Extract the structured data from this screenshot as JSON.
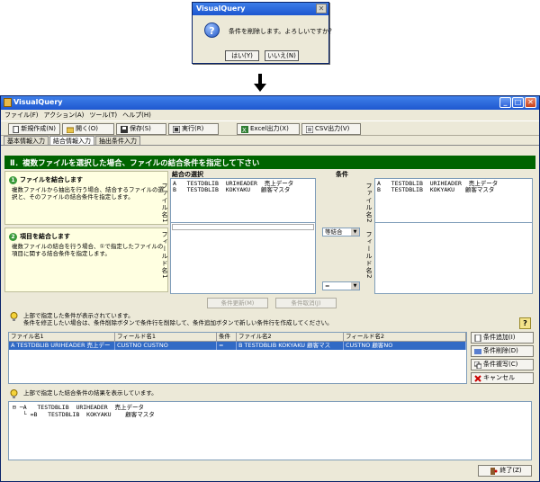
{
  "dialog": {
    "title": "VisualQuery",
    "message": "条件を削除します。よろしいですか？",
    "yes_label": "はい(Y)",
    "no_label": "いいえ(N)"
  },
  "window": {
    "title": "VisualQuery",
    "menu": [
      "ファイル(F)",
      "アクション(A)",
      "ツール(T)",
      "ヘルプ(H)"
    ],
    "toolbar": {
      "new_label": "新規作成(N)",
      "open_label": "開く(O)",
      "save_label": "保存(S)",
      "run_label": "実行(R)",
      "excel_label": "Excel出力(X)",
      "csv_label": "CSV出力(V)"
    },
    "tabs": [
      "基本情報入力",
      "結合情報入力",
      "抽出条件入力"
    ],
    "active_tab": "結合情報入力"
  },
  "section": {
    "header": "Ⅱ．複数ファイルを選択した場合、ファイルの結合条件を指定して下さい"
  },
  "panel1": {
    "number": "1",
    "title": "ファイルを結合します",
    "text": "複数ファイルから抽出を行う場合、結合するファイルの選択と、そのファイルの結合条件を指定します。"
  },
  "panel2": {
    "number": "2",
    "title": "項目を結合します",
    "text": "複数ファイルの結合を行う場合、①で指定したファイルの項目に関する結合条件を指定します。"
  },
  "join": {
    "select_label": "結合の選択",
    "condition_label": "条件",
    "file1_vlabel": "ファイル名1",
    "file2_vlabel": "ファイル名2",
    "field1_vlabel": "フィールド名1",
    "field2_vlabel": "フィールド名2",
    "file1_lines": "A   TESTDBLIB  URIHEADER  売上データ\nB   TESTDBLIB  KOKYAKU   顧客マスタ",
    "file2_lines": "A   TESTDBLIB  URIHEADER  売上データ\nB   TESTDBLIB  KOKYAKU   顧客マスタ",
    "join_type": "等結合",
    "operator": "="
  },
  "buttons": {
    "update_label": "条件更新(M)",
    "cancel_cond_label": "条件取消(J)",
    "add_label": "条件追加(I)",
    "delete_label": "条件削除(D)",
    "copy_label": "条件複写(C)",
    "cancel_label": "キャンセル",
    "exit_label": "終了(Z)"
  },
  "conditions": {
    "info": "上部で指定した条件が表示されています。\n条件を修正したい場合は、条件削除ボタンで条件行を削除して、条件追加ボタンで新しい条件行を作成してください。",
    "headers": [
      "ファイル名1",
      "フィールド名1",
      "条件",
      "ファイル名2",
      "フィールド名2"
    ],
    "row": [
      "A   TESTDBLIB  URIHEADER  売上デー",
      "CUSTNO      CUSTNO",
      "=",
      "B   TESTDBLIB  KOKYAKU   顧客マス",
      "CUSTNO      顧客NO"
    ]
  },
  "result": {
    "info": "上部で指定した結合条件の結果を表示しています。",
    "tree": "⊟ ─A   TESTDBLIB  URIHEADER  売上データ\n   └ =B   TESTDBLIB  KOKYAKU    顧客マスタ"
  }
}
